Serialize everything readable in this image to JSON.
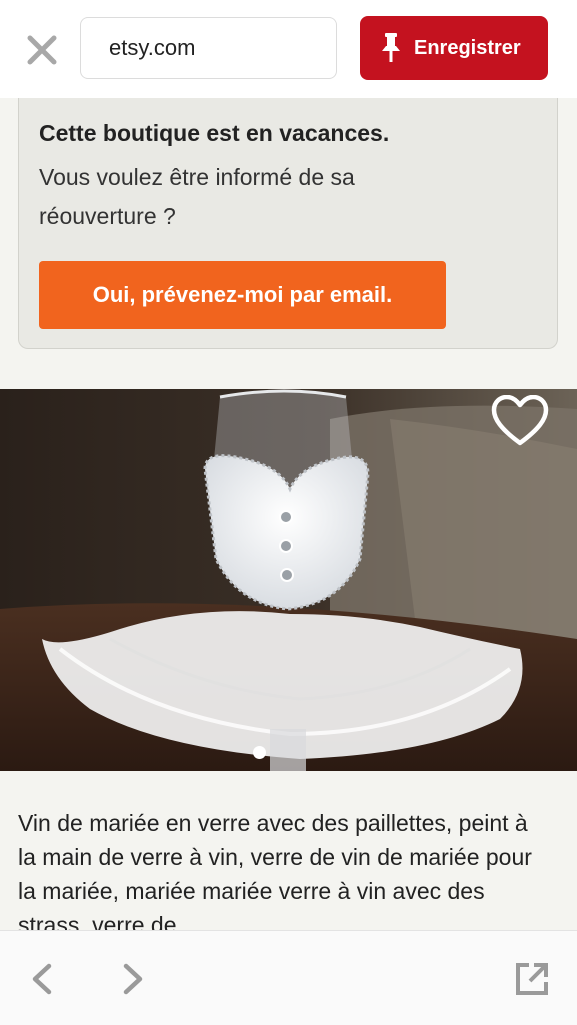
{
  "topbar": {
    "url": "etsy.com",
    "save_label": "Enregistrer",
    "close_icon": "close-icon",
    "save_icon": "pushpin-icon",
    "brand_color": "#c4121f"
  },
  "vacation": {
    "title": "Cette boutique est en vacances.",
    "line1": "Vous voulez être informé de sa",
    "line2": "réouverture ?",
    "button_label": "Oui, prévenez-moi par email.",
    "button_color": "#f1641e"
  },
  "product": {
    "favorite_icon": "heart-outline-icon",
    "image_count_visible": 1,
    "active_image": 1,
    "description": "Vin de mariée en verre avec des paillettes, peint à la main de verre à vin, verre de vin de mariée pour la mariée, mariée mariée verre à vin avec des strass, verre de"
  },
  "bottombar": {
    "back_icon": "chevron-left-icon",
    "forward_icon": "chevron-right-icon",
    "share_icon": "open-external-icon"
  }
}
